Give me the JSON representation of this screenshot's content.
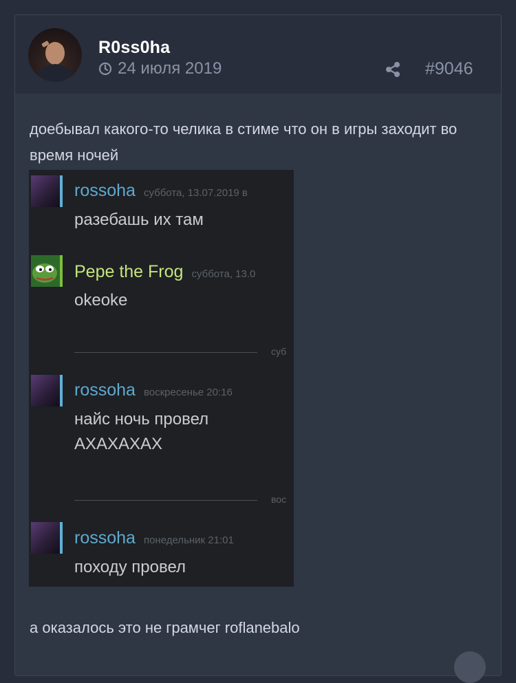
{
  "post": {
    "author": "R0ss0ha",
    "date": "24 июля 2019",
    "number": "#9046",
    "text_before": "доебывал какого-то челика в стиме что он в игры заходит во время ночей",
    "text_after": "а оказалось это не грамчег roflanebalo"
  },
  "icons": {
    "clock": "clock-icon",
    "share": "share-icon"
  },
  "chat": {
    "messages": [
      {
        "author": "rossoha",
        "timestamp": "суббота, 13.07.2019 в",
        "text": "разебашь их там"
      },
      {
        "author": "Pepe the Frog",
        "timestamp": "суббота, 13.0",
        "text": "okeoke"
      },
      {
        "author": "rossoha",
        "timestamp": "воскресенье 20:16",
        "text": "найс ночь провел\nАХАХАХАХ"
      },
      {
        "author": "rossoha",
        "timestamp": "понедельник 21:01",
        "text": "походу провел"
      }
    ],
    "dividers": [
      "суб",
      "вос"
    ]
  },
  "colors": {
    "page_bg": "#272d3a",
    "card_bg": "#2f3644",
    "header_bg": "#282e3b",
    "muted": "#8a93a6",
    "steam_bg": "#1e2024",
    "steam_name_blue": "#5fa9cf",
    "steam_name_green": "#c5e57c"
  }
}
